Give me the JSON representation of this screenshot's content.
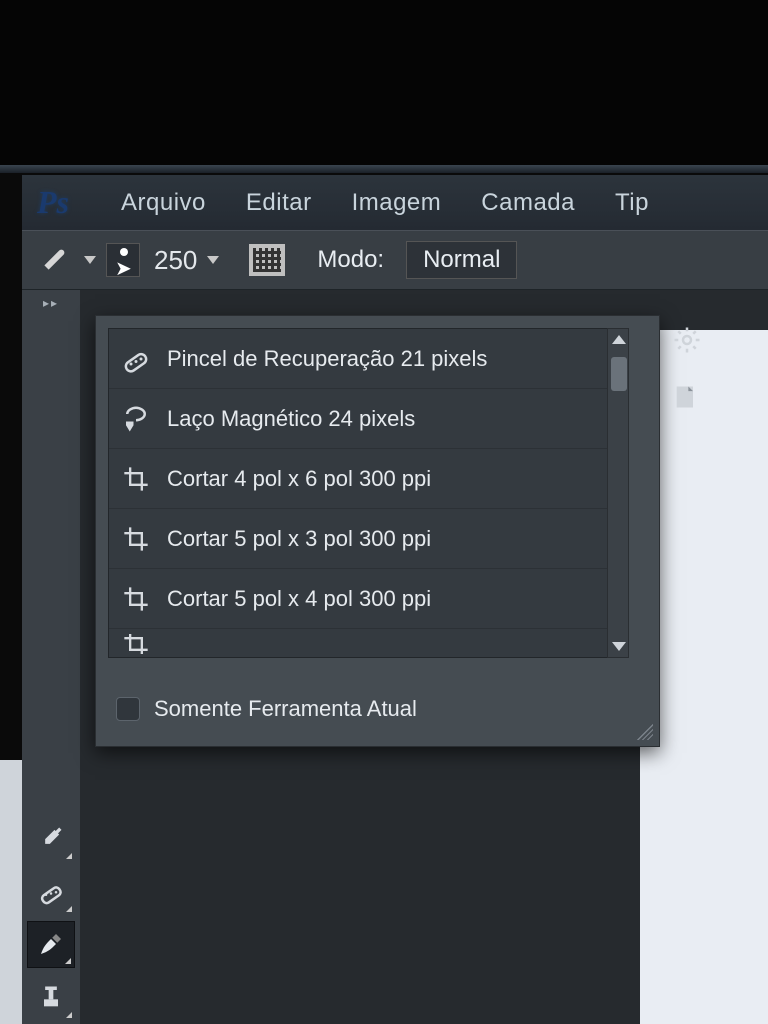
{
  "app": {
    "logo": "Ps"
  },
  "menubar": [
    "Arquivo",
    "Editar",
    "Imagem",
    "Camada",
    "Tip"
  ],
  "optionsbar": {
    "brush_size": "250",
    "modo_label": "Modo:",
    "modo_value": "Normal"
  },
  "preset_panel": {
    "items": [
      {
        "icon": "healing-brush-icon",
        "label": "Pincel de Recuperação 21 pixels"
      },
      {
        "icon": "magnetic-lasso-icon",
        "label": "Laço Magnético 24 pixels"
      },
      {
        "icon": "crop-icon",
        "label": "Cortar 4 pol x 6 pol 300 ppi"
      },
      {
        "icon": "crop-icon",
        "label": "Cortar 5 pol x 3 pol 300 ppi"
      },
      {
        "icon": "crop-icon",
        "label": "Cortar 5 pol x 4 pol 300 ppi"
      }
    ],
    "footer_label": "Somente Ferramenta Atual"
  }
}
